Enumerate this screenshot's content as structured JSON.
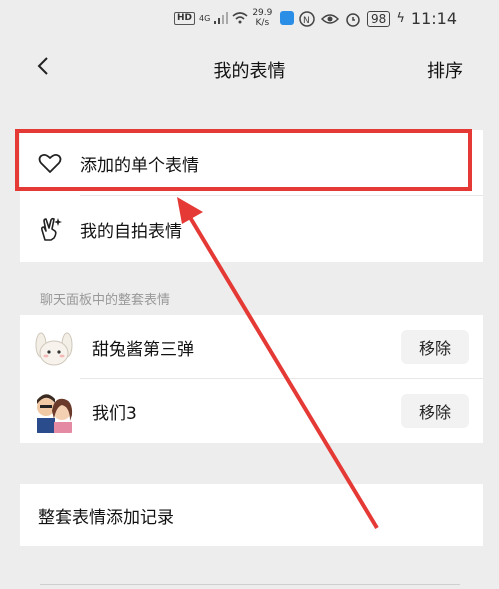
{
  "status_bar": {
    "hd": "HD",
    "signal": "4G",
    "net_speed_value": "29.9",
    "net_speed_unit": "K/s",
    "battery": "98",
    "time": "11:14"
  },
  "nav": {
    "title": "我的表情",
    "sort_label": "排序"
  },
  "single_section": {
    "items": [
      {
        "label": "添加的单个表情",
        "icon": "heart-icon"
      },
      {
        "label": "我的自拍表情",
        "icon": "selfie-hand-icon"
      }
    ]
  },
  "packs_section": {
    "title": "聊天面板中的整套表情",
    "packs": [
      {
        "name": "甜兔酱第三弹",
        "remove_label": "移除",
        "avatar": "rabbit-sticker-avatar"
      },
      {
        "name": "我们3",
        "remove_label": "移除",
        "avatar": "couple-sticker-avatar"
      }
    ]
  },
  "history": {
    "label": "整套表情添加记录"
  },
  "annotation": {
    "color": "#e53935"
  }
}
